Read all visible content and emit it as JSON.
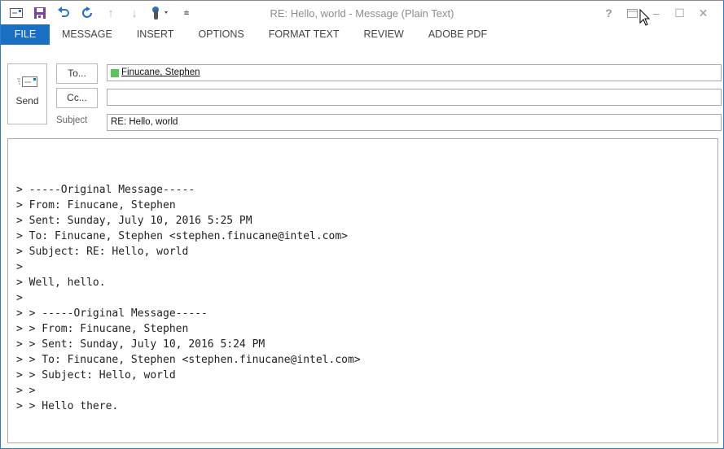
{
  "window": {
    "title": "RE: Hello, world - Message (Plain Text)"
  },
  "qat": {
    "icons": [
      "message-icon",
      "save-icon",
      "undo-icon",
      "redo-icon",
      "previous-item-icon",
      "next-item-icon",
      "touch-mode-icon",
      "customize-qat-icon"
    ]
  },
  "window_controls": {
    "help": "?",
    "ribbon_display": "▭",
    "minimize": "–",
    "maximize": "☐",
    "close": "✕"
  },
  "ribbon": {
    "tabs": [
      "FILE",
      "MESSAGE",
      "INSERT",
      "OPTIONS",
      "FORMAT TEXT",
      "REVIEW",
      "ADOBE PDF"
    ]
  },
  "compose": {
    "send_label": "Send",
    "to_button": "To...",
    "cc_button": "Cc...",
    "subject_label": "Subject",
    "to_recipient": "Finucane, Stephen",
    "cc_value": "",
    "subject_value": "RE: Hello, world",
    "presence_color": "#5cc45c"
  },
  "body": {
    "lines": [
      "",
      "",
      "",
      "> -----Original Message-----",
      "> From: Finucane, Stephen",
      "> Sent: Sunday, July 10, 2016 5:25 PM",
      "> To: Finucane, Stephen <stephen.finucane@intel.com>",
      "> Subject: RE: Hello, world",
      ">",
      "> Well, hello.",
      ">",
      "> > -----Original Message-----",
      "> > From: Finucane, Stephen",
      "> > Sent: Sunday, July 10, 2016 5:24 PM",
      "> > To: Finucane, Stephen <stephen.finucane@intel.com>",
      "> > Subject: Hello, world",
      "> >",
      "> > Hello there."
    ]
  }
}
